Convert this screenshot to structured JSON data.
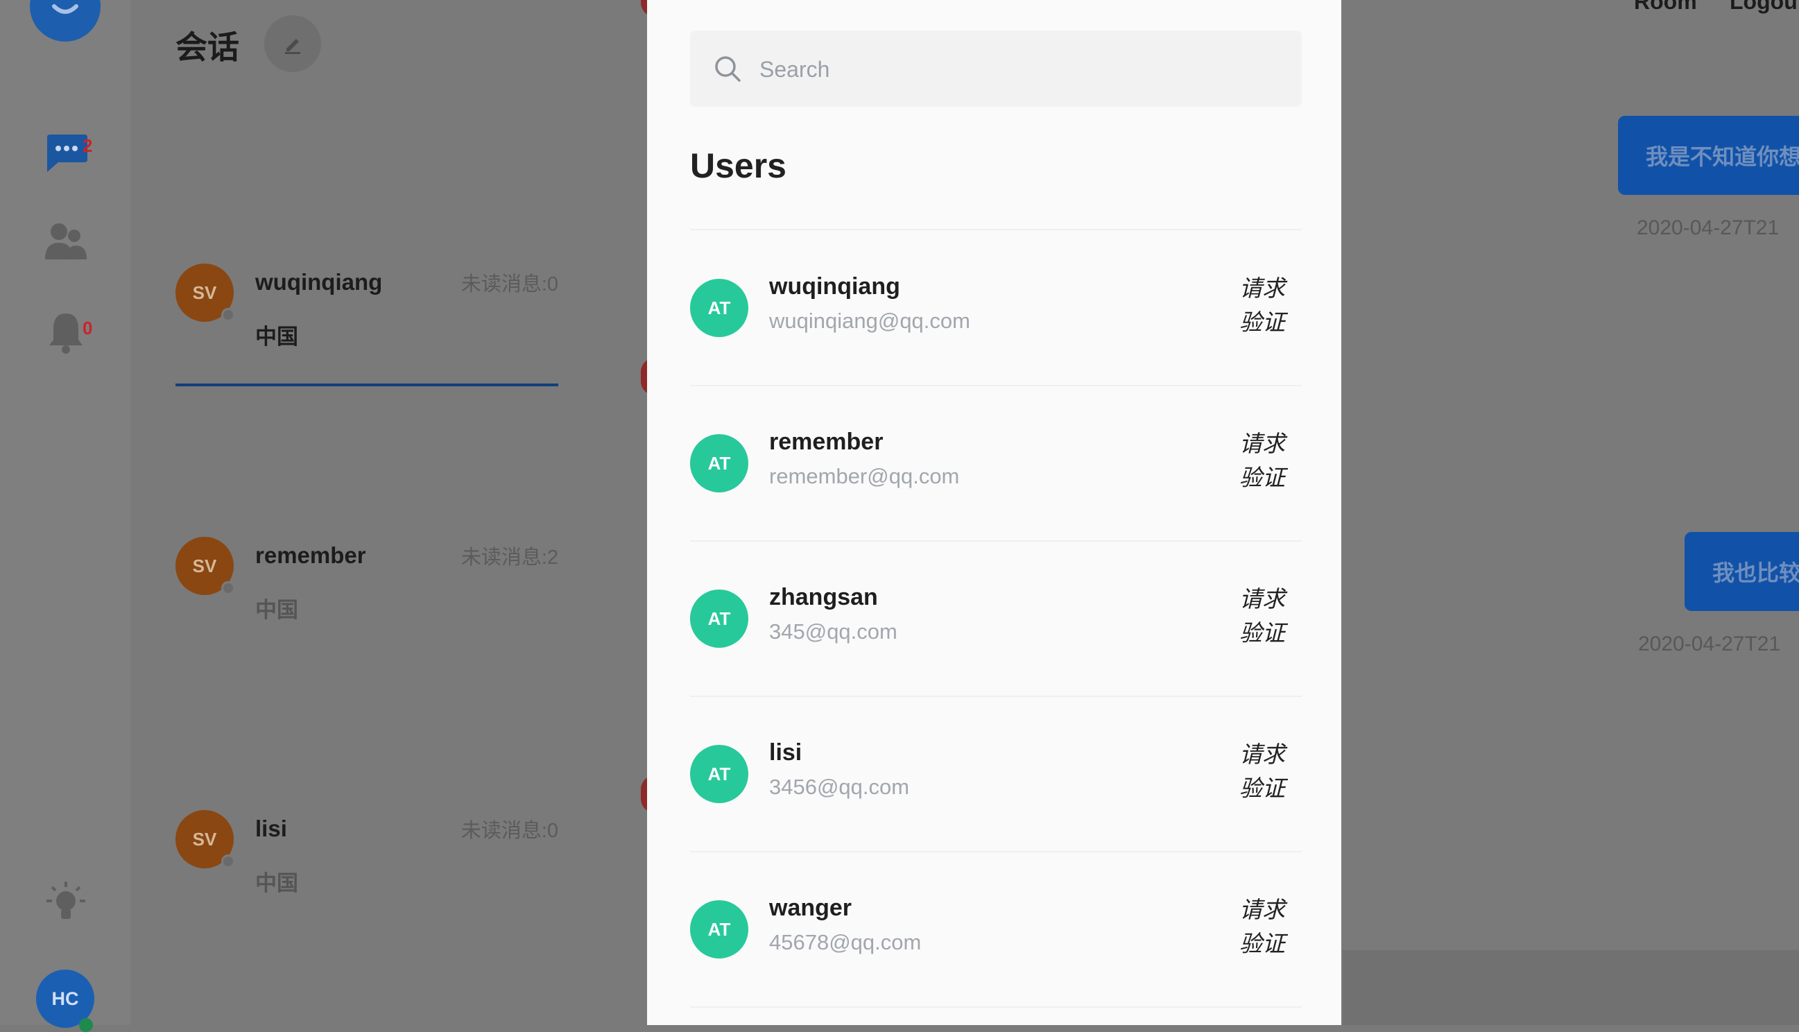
{
  "background": {
    "nav": {
      "chat_badge": "2",
      "notify_badge": "0",
      "user_avatar": "HC"
    },
    "list": {
      "title": "会话",
      "conversations": [
        {
          "avatar": "SV",
          "name": "wuqinqiang",
          "unread": "未读消息:0",
          "message": "中国"
        },
        {
          "avatar": "SV",
          "name": "remember",
          "unread": "未读消息:2",
          "message": "中国"
        },
        {
          "avatar": "SV",
          "name": "lisi",
          "unread": "未读消息:0",
          "message": "中国"
        }
      ]
    },
    "chat": {
      "top_links": [
        "Room",
        "Logout"
      ],
      "messages": [
        {
          "text": "我是不知道你想",
          "time": "2020-04-27T21"
        },
        {
          "text": "我也比较",
          "time": "2020-04-27T21"
        }
      ]
    }
  },
  "modal": {
    "search": {
      "placeholder": "Search"
    },
    "title": "Users",
    "users": [
      {
        "avatar": "AT",
        "name": "wuqinqiang",
        "email": "wuqinqiang@qq.com",
        "action_line1": "请求",
        "action_line2": "验证"
      },
      {
        "avatar": "AT",
        "name": "remember",
        "email": "remember@qq.com",
        "action_line1": "请求",
        "action_line2": "验证"
      },
      {
        "avatar": "AT",
        "name": "zhangsan",
        "email": "345@qq.com",
        "action_line1": "请求",
        "action_line2": "验证"
      },
      {
        "avatar": "AT",
        "name": "lisi",
        "email": "3456@qq.com",
        "action_line1": "请求",
        "action_line2": "验证"
      },
      {
        "avatar": "AT",
        "name": "wanger",
        "email": "45678@qq.com",
        "action_line1": "请求",
        "action_line2": "验证"
      }
    ]
  },
  "colors": {
    "primary": "#1152a8",
    "avatar_green": "#27c99a",
    "avatar_orange": "#8a4712",
    "badge_red": "#c8242a"
  }
}
